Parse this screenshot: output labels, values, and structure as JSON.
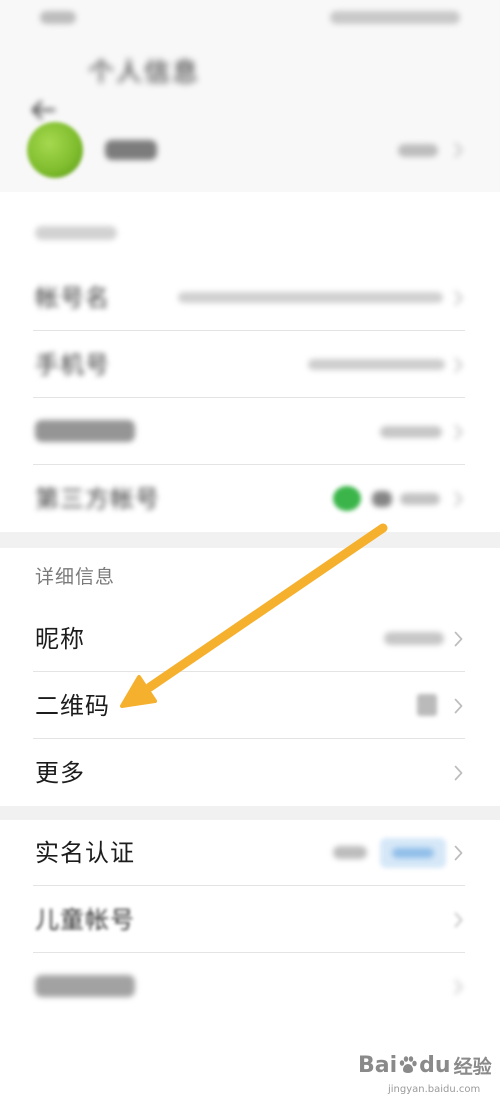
{
  "header": {
    "title": "个人信息",
    "back_icon": "back-arrow-icon"
  },
  "profile": {
    "avatar_color": "#7dbb2c"
  },
  "account_section": {
    "rows": [
      {
        "label": "帐号名"
      },
      {
        "label": "手机号"
      },
      {},
      {
        "label": "第三方帐号",
        "icon": "wechat-icon",
        "icon_color": "#3bb54a"
      }
    ]
  },
  "detail_section": {
    "header": "详细信息",
    "rows": [
      {
        "label": "昵称"
      },
      {
        "label": "二维码",
        "icon": "qr-code-icon"
      },
      {
        "label": "更多"
      }
    ]
  },
  "other_section": {
    "rows": [
      {
        "label": "实名认证",
        "badge_color": "#d6e8f8"
      },
      {
        "label": "儿童帐号"
      },
      {}
    ]
  },
  "annotation": {
    "arrow_color": "#f5b02e"
  },
  "watermark": {
    "brand_left": "Bai",
    "brand_right": "du",
    "product": "经验",
    "url": "jingyan.baidu.com"
  },
  "icons": {
    "chevron": "chevron-right-icon",
    "paw": "baidu-paw-icon"
  },
  "colors": {
    "background": "#ffffff",
    "section_gap": "#f1f1f1",
    "divider": "#e4e4e4",
    "label": "#1c1c1c",
    "section_header": "#7a7a7a"
  }
}
